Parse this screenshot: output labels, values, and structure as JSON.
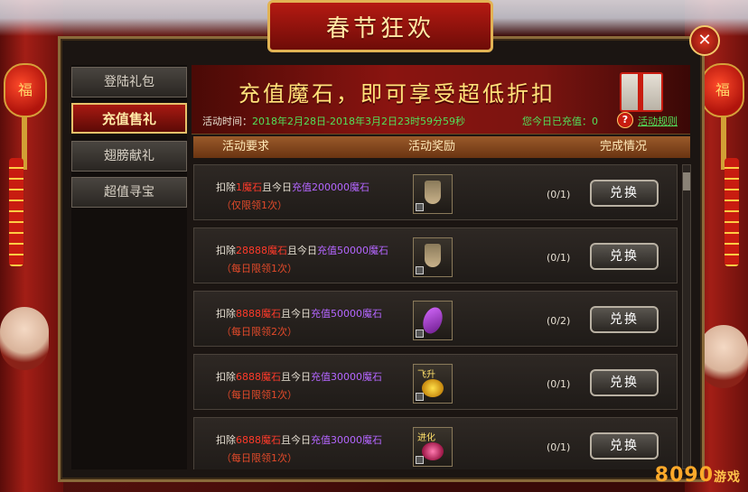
{
  "event_title": "春节狂欢",
  "close_glyph": "✕",
  "tabs": [
    {
      "label": "登陆礼包"
    },
    {
      "label": "充值售礼"
    },
    {
      "label": "翅膀献礼"
    },
    {
      "label": "超值寻宝"
    }
  ],
  "headline": "充值魔石，即可享受超低折扣",
  "activity_time_label": "活动时间：",
  "activity_time_value": "2018年2月28日-2018年3月2日23时59分59秒",
  "recharge_today": "您今日已充值：0",
  "rules_link": "活动规则",
  "columns": {
    "requirement": "活动要求",
    "reward": "活动奖励",
    "status": "完成情况"
  },
  "rows": [
    {
      "pre": "扣除",
      "cost": "1魔石",
      "mid": "且今日",
      "recharge": "充值200000魔石",
      "limit": "（仅限领1次）",
      "reward_tag": "",
      "progress": "(0/1)",
      "button": "兑换"
    },
    {
      "pre": "扣除",
      "cost": "28888魔石",
      "mid": "且今日",
      "recharge": "充值50000魔石",
      "limit": "（每日限领1次）",
      "reward_tag": "",
      "progress": "(0/1)",
      "button": "兑换"
    },
    {
      "pre": "扣除",
      "cost": "8888魔石",
      "mid": "且今日",
      "recharge": "充值50000魔石",
      "limit": "（每日限领2次）",
      "reward_tag": "",
      "progress": "(0/2)",
      "button": "兑换"
    },
    {
      "pre": "扣除",
      "cost": "6888魔石",
      "mid": "且今日",
      "recharge": "充值30000魔石",
      "limit": "（每日限领1次）",
      "reward_tag": "飞升",
      "progress": "(0/1)",
      "button": "兑换"
    },
    {
      "pre": "扣除",
      "cost": "6888魔石",
      "mid": "且今日",
      "recharge": "充值30000魔石",
      "limit": "（每日限领1次）",
      "reward_tag": "进化",
      "progress": "(0/1)",
      "button": "兑换"
    }
  ],
  "lantern_char": "福",
  "watermark": {
    "num": "8090",
    "cn": "游戏"
  },
  "colors": {
    "accent_gold": "#e7c16a",
    "cost_red": "#ff3a2a",
    "recharge_purple": "#b466ff",
    "info_green": "#52e05a"
  }
}
